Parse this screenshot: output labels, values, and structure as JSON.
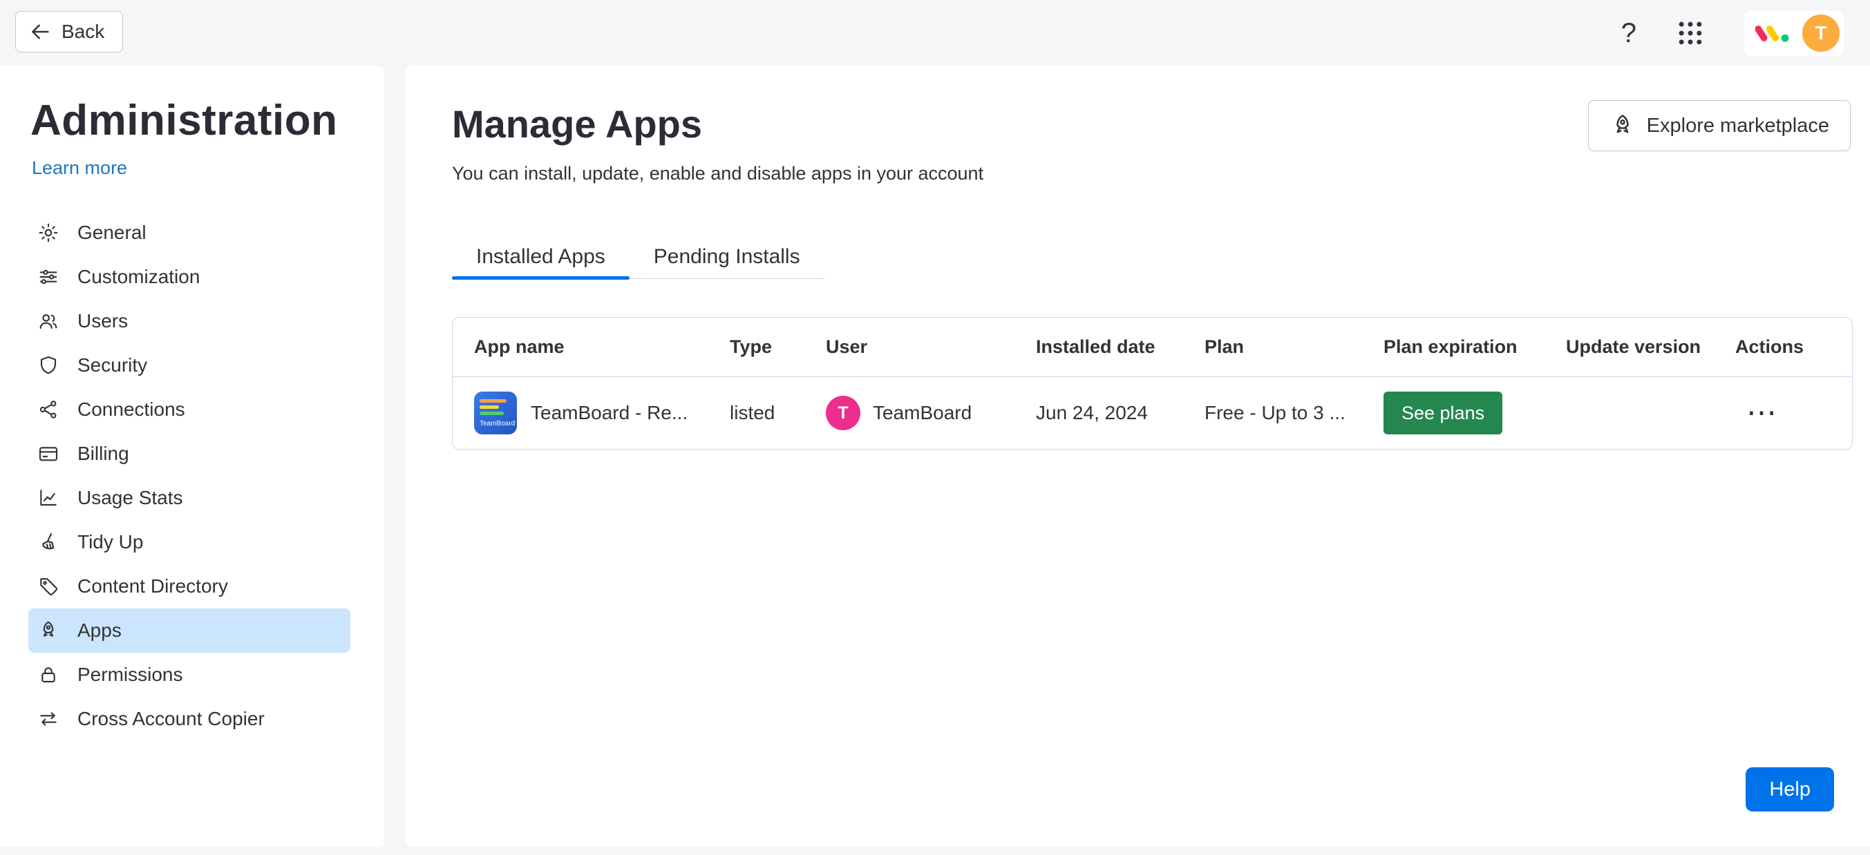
{
  "topbar": {
    "back_label": "Back",
    "help_icon_glyph": "?",
    "avatar_letter": "T"
  },
  "sidebar": {
    "title": "Administration",
    "learn_more_label": "Learn more",
    "items": [
      {
        "label": "General",
        "icon": "gear-icon",
        "selected": false
      },
      {
        "label": "Customization",
        "icon": "sliders-icon",
        "selected": false
      },
      {
        "label": "Users",
        "icon": "users-icon",
        "selected": false
      },
      {
        "label": "Security",
        "icon": "shield-icon",
        "selected": false
      },
      {
        "label": "Connections",
        "icon": "nodes-icon",
        "selected": false
      },
      {
        "label": "Billing",
        "icon": "credit-card-icon",
        "selected": false
      },
      {
        "label": "Usage Stats",
        "icon": "line-chart-icon",
        "selected": false
      },
      {
        "label": "Tidy Up",
        "icon": "broom-icon",
        "selected": false
      },
      {
        "label": "Content Directory",
        "icon": "tag-icon",
        "selected": false
      },
      {
        "label": "Apps",
        "icon": "rocket-icon",
        "selected": true
      },
      {
        "label": "Permissions",
        "icon": "lock-icon",
        "selected": false
      },
      {
        "label": "Cross Account Copier",
        "icon": "transfer-arrows-icon",
        "selected": false
      }
    ]
  },
  "main": {
    "title": "Manage Apps",
    "subtitle": "You can install, update, enable and disable apps in your account",
    "explore_button_label": "Explore marketplace",
    "tabs": [
      {
        "label": "Installed Apps",
        "active": true
      },
      {
        "label": "Pending Installs",
        "active": false
      }
    ],
    "table": {
      "columns": [
        "App name",
        "Type",
        "User",
        "Installed date",
        "Plan",
        "Plan expiration",
        "Update version",
        "Actions"
      ],
      "rows": [
        {
          "app_icon_text": "TeamBoard",
          "app_name": "TeamBoard - Re...",
          "type": "listed",
          "user_avatar_letter": "T",
          "user": "TeamBoard",
          "installed_date": "Jun 24, 2024",
          "plan": "Free - Up to 3 ...",
          "plan_expiration_button": "See plans",
          "update_version": "",
          "actions_glyph": "⋯"
        }
      ]
    }
  },
  "help_button_label": "Help",
  "colors": {
    "accent_blue": "#0073ea",
    "link_blue": "#1f76c2",
    "selected_item_bg": "#cce5ff",
    "green_button": "#258750",
    "user_avatar_pink": "#ed2e8c",
    "account_avatar_orange": "#fdab3d",
    "monday_logo_red": "#f62b54",
    "monday_logo_yellow": "#ffcc00",
    "monday_logo_green": "#00c875",
    "page_bg": "#f5f6f8",
    "border": "#d0d4e4"
  }
}
